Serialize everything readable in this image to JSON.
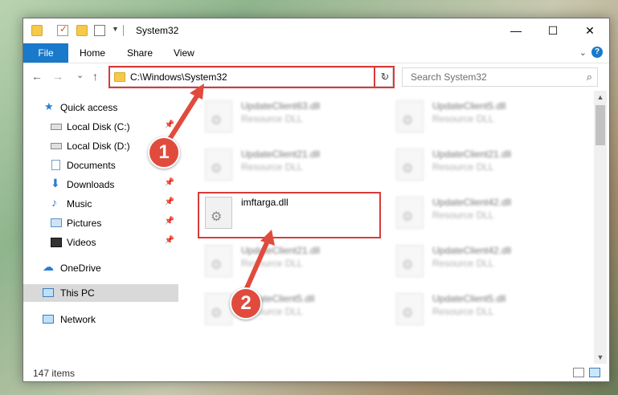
{
  "window": {
    "title": "System32",
    "controls": {
      "minimize": "—",
      "maximize": "☐",
      "close": "✕"
    }
  },
  "ribbon": {
    "tabs": [
      "File",
      "Home",
      "Share",
      "View"
    ],
    "expand_icon": "chevron-down-icon",
    "help_label": "?"
  },
  "address": {
    "path": "C:\\Windows\\System32",
    "search_placeholder": "Search System32",
    "back": "←",
    "forward": "→",
    "recent": "⌄",
    "up": "↑",
    "refresh": "↻",
    "dropdown": "⌄",
    "search_icon": "⌕"
  },
  "sidebar": {
    "items": [
      {
        "label": "Quick access",
        "icon": "star-icon"
      },
      {
        "label": "Local Disk (C:)",
        "icon": "drive-icon",
        "pinned": true
      },
      {
        "label": "Local Disk (D:)",
        "icon": "drive-icon",
        "pinned": true
      },
      {
        "label": "Documents",
        "icon": "document-icon",
        "pinned": true
      },
      {
        "label": "Downloads",
        "icon": "download-icon",
        "pinned": true
      },
      {
        "label": "Music",
        "icon": "music-icon",
        "pinned": true
      },
      {
        "label": "Pictures",
        "icon": "picture-icon",
        "pinned": true
      },
      {
        "label": "Videos",
        "icon": "video-icon",
        "pinned": true
      },
      {
        "label": "OneDrive",
        "icon": "cloud-icon"
      },
      {
        "label": "This PC",
        "icon": "computer-icon",
        "selected": true
      },
      {
        "label": "Network",
        "icon": "network-icon"
      }
    ],
    "pin_glyph": "📌"
  },
  "files": [
    {
      "name": "UpdateClient63.dll",
      "type": "Resource DLL"
    },
    {
      "name": "UpdateClient5.dll",
      "type": "Resource DLL"
    },
    {
      "name": "UpdateClient21.dll",
      "type": "Resource DLL"
    },
    {
      "name": "UpdateClient21.dll",
      "type": "Resource DLL"
    },
    {
      "name": "imftarga.dll",
      "type": ""
    },
    {
      "name": "UpdateClient42.dll",
      "type": "Resource DLL"
    },
    {
      "name": "UpdateClient21.dll",
      "type": "Resource DLL"
    },
    {
      "name": "UpdateClient42.dll",
      "type": "Resource DLL"
    },
    {
      "name": "UpdateClient5.dll",
      "type": "Resource DLL"
    },
    {
      "name": "UpdateClient5.dll",
      "type": "Resource DLL"
    }
  ],
  "status": {
    "item_count": "147 items"
  },
  "annotations": {
    "step1": "1",
    "step2": "2",
    "color": "#e04b3e"
  },
  "scroll": {
    "up": "▲",
    "down": "▼"
  }
}
